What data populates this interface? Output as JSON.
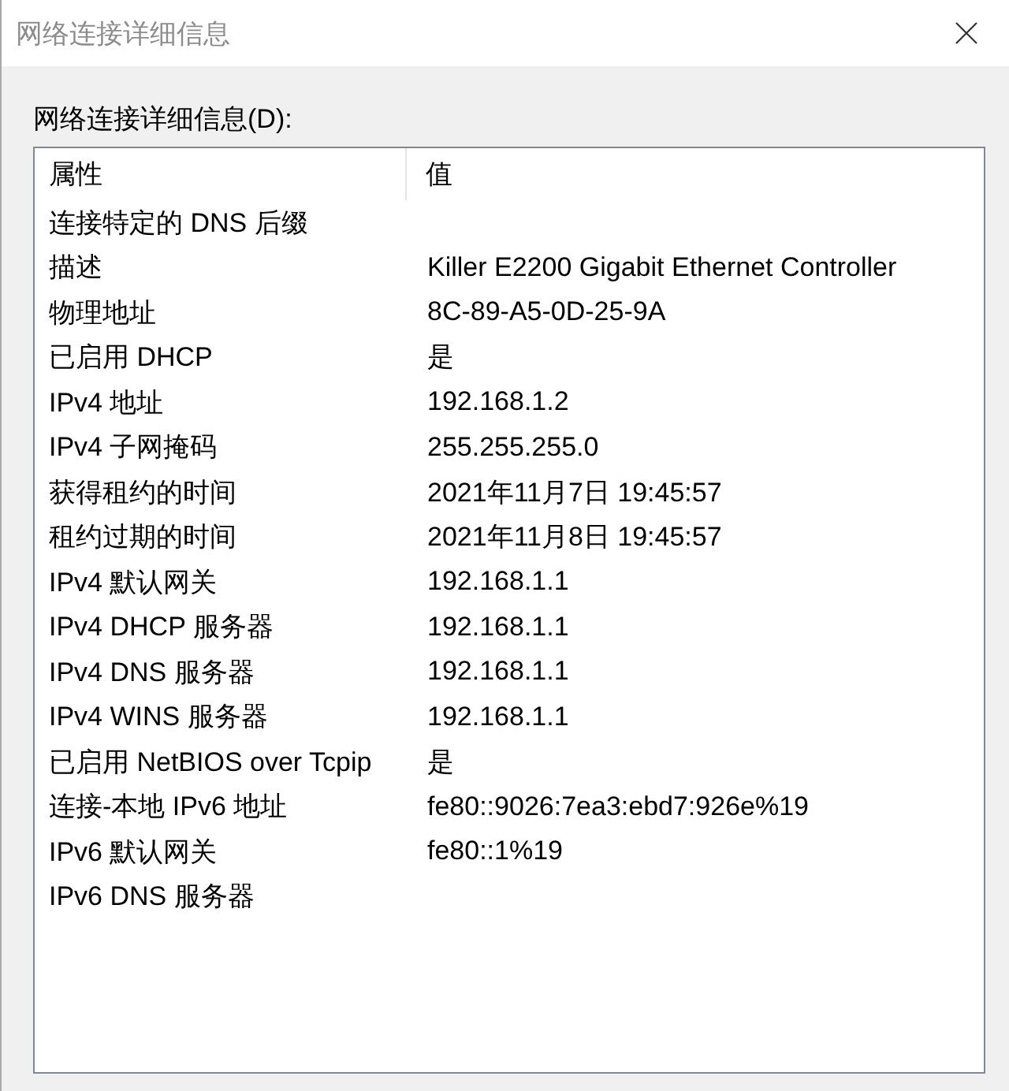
{
  "window": {
    "title": "网络连接详细信息"
  },
  "details": {
    "label": "网络连接详细信息(D):",
    "columns": [
      "属性",
      "值"
    ],
    "rows": [
      {
        "property": "连接特定的 DNS 后缀"
      },
      {
        "property": "描述",
        "value": "Killer E2200 Gigabit Ethernet Controller"
      },
      {
        "property": "物理地址",
        "value": "8C-89-A5-0D-25-9A"
      },
      {
        "property": "已启用 DHCP",
        "value": "是"
      },
      {
        "property": "IPv4 地址",
        "value": "192.168.1.2"
      },
      {
        "property": "IPv4 子网掩码",
        "value": "255.255.255.0"
      },
      {
        "property": "获得租约的时间",
        "value": "2021年11月7日 19:45:57"
      },
      {
        "property": "租约过期的时间",
        "value": "2021年11月8日 19:45:57"
      },
      {
        "property": "IPv4 默认网关",
        "value": "192.168.1.1"
      },
      {
        "property": "IPv4 DHCP 服务器",
        "value": "192.168.1.1"
      },
      {
        "property": "IPv4 DNS 服务器",
        "value": "192.168.1.1"
      },
      {
        "property": "IPv4 WINS 服务器",
        "value": "192.168.1.1"
      },
      {
        "property": "已启用 NetBIOS over Tcpip",
        "value": "是"
      },
      {
        "property": "连接-本地 IPv6 地址",
        "value": "fe80::9026:7ea3:ebd7:926e%19"
      },
      {
        "property": "IPv6 默认网关",
        "value": "fe80::1%19"
      },
      {
        "property": "IPv6 DNS 服务器"
      }
    ]
  }
}
